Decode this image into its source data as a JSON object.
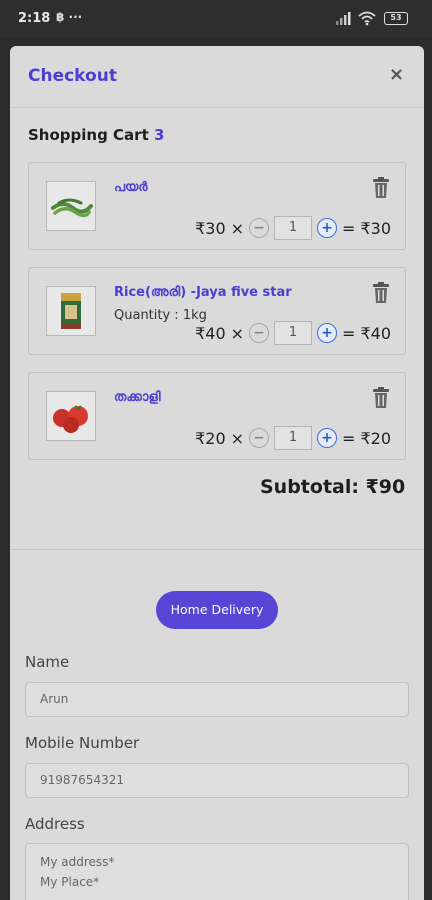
{
  "status_bar": {
    "time": "2:18",
    "extra_icons": "฿ ···",
    "battery": "53"
  },
  "modal": {
    "title": "Checkout",
    "close": "×"
  },
  "cart": {
    "heading": "Shopping Cart",
    "count": "3",
    "items": [
      {
        "name": "പയർ",
        "quantity_text": "",
        "unit_price": "₹30",
        "times": "×",
        "qty": "1",
        "equals": "=",
        "line_total": "₹30"
      },
      {
        "name": "Rice(അരി) -Jaya five star",
        "quantity_text": "Quantity : 1kg",
        "unit_price": "₹40",
        "times": "×",
        "qty": "1",
        "equals": "=",
        "line_total": "₹40"
      },
      {
        "name": "തക്കാളി",
        "quantity_text": "",
        "unit_price": "₹20",
        "times": "×",
        "qty": "1",
        "equals": "=",
        "line_total": "₹20"
      }
    ],
    "subtotal": "Subtotal: ₹90"
  },
  "delivery": {
    "button_label": "Home Delivery"
  },
  "form": {
    "name_label": "Name",
    "name_value": "Arun",
    "mobile_label": "Mobile Number",
    "mobile_value": "91987654321",
    "address_label": "Address",
    "address_line1": "My address*",
    "address_line2": "My Place*"
  },
  "colors": {
    "accent": "#4a3fd0",
    "button": "#5646d6",
    "backdrop": "#2b2b2b",
    "panel": "#dadada"
  }
}
